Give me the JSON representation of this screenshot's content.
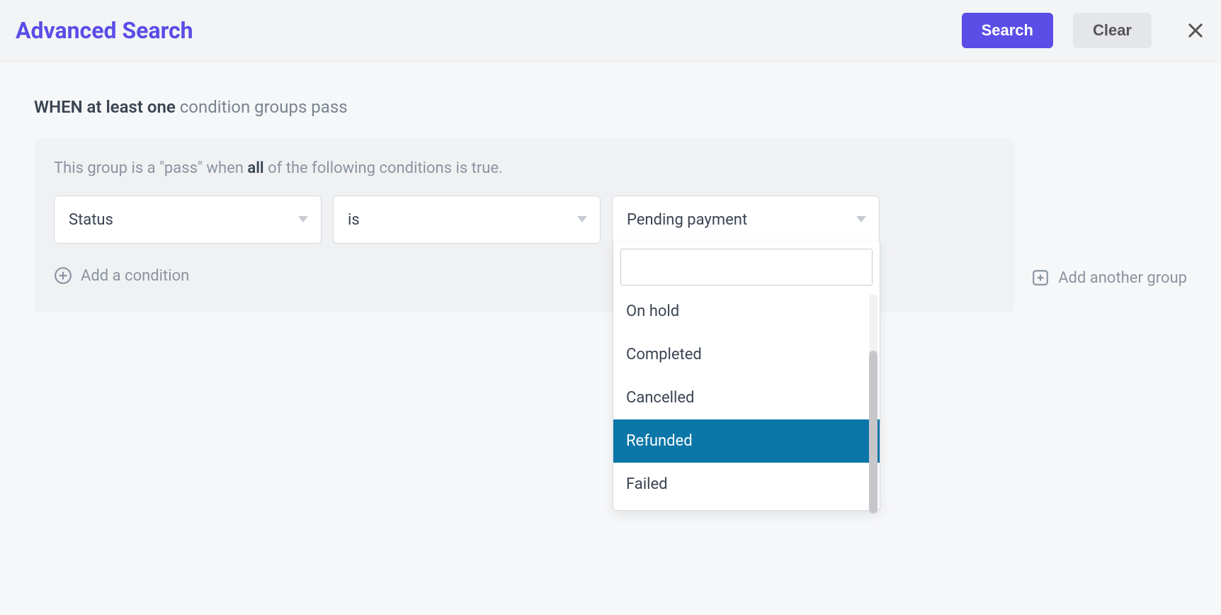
{
  "header": {
    "title": "Advanced Search",
    "search_label": "Search",
    "clear_label": "Clear"
  },
  "rule": {
    "when_prefix": "WHEN",
    "when_mode": "at least one",
    "when_suffix": "condition groups pass"
  },
  "group": {
    "desc_prefix": "This group is a \"pass\" when",
    "desc_mode": "all",
    "desc_suffix": "of the following conditions is true.",
    "condition": {
      "field": "Status",
      "operator": "is",
      "value": "Pending payment"
    },
    "add_condition_label": "Add a condition"
  },
  "add_group_label": "Add another group",
  "dropdown": {
    "search_value": "",
    "options": [
      "On hold",
      "Completed",
      "Cancelled",
      "Refunded",
      "Failed"
    ],
    "highlighted": "Refunded"
  }
}
